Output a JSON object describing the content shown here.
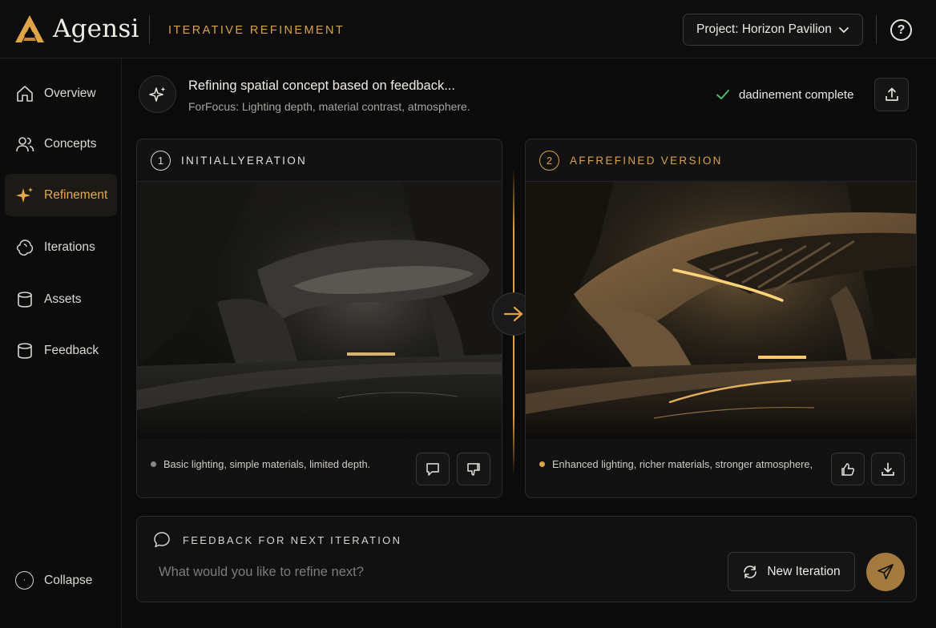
{
  "header": {
    "brand": "Agensi",
    "section_title": "ITERATIVE REFINEMENT",
    "project_select": "Project: Horizon Pavilion",
    "help_label": "?"
  },
  "sidebar": {
    "items": [
      {
        "label": "Overview",
        "icon": "home-icon"
      },
      {
        "label": "Concepts",
        "icon": "users-icon"
      },
      {
        "label": "Refinement",
        "icon": "sparkle-icon",
        "active": true
      },
      {
        "label": "Iterations",
        "icon": "iterations-icon"
      },
      {
        "label": "Assets",
        "icon": "database-icon"
      },
      {
        "label": "Feedback",
        "icon": "database-icon"
      }
    ],
    "collapse_label": "Collapse"
  },
  "status": {
    "title": "Refining spatial concept based on feedback...",
    "subtitle": "ForFocus: Lighting depth, material contrast, atmosphere.",
    "complete_label": "dadinement complete"
  },
  "cards": {
    "left": {
      "number": "1",
      "title": "INITIALLYERATION",
      "caption": "Basic lighting, simple materials, limited depth.",
      "dot_color": "#8a8784"
    },
    "right": {
      "number": "2",
      "title": "AFFREFINED VERSION",
      "caption": "Enhanced lighting, richer materials, stronger atmosphere,",
      "dot_color": "#e0a447"
    }
  },
  "feedback": {
    "label": "FEEDBACK FOR NEXT ITERATION",
    "placeholder": "What would you like to refine next?",
    "new_iteration_label": "New Iteration"
  },
  "colors": {
    "accent": "#d9a24a",
    "background": "#0b0b0c",
    "success": "#4fb86a"
  }
}
